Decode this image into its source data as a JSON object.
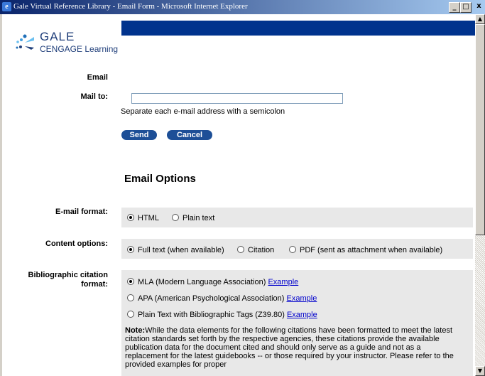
{
  "window": {
    "title": "Gale Virtual Reference Library - Email Form - Microsoft Internet Explorer",
    "min": "_",
    "max": "□",
    "close": "x"
  },
  "logo": {
    "name": "GALE",
    "subtitle": "CENGAGE Learning"
  },
  "form": {
    "email_label": "Email",
    "mail_to_label": "Mail to:",
    "mail_to_value": "",
    "hint": "Separate each e-mail address with a semicolon",
    "send": "Send",
    "cancel": "Cancel"
  },
  "options": {
    "title": "Email Options",
    "format_label": "E-mail format:",
    "format_options": [
      "HTML",
      "Plain text"
    ],
    "content_label": "Content options:",
    "content_options": [
      "Full text (when available)",
      "Citation",
      "PDF (sent as attachment when available)"
    ],
    "biblio_label_1": "Bibliographic citation",
    "biblio_label_2": "format:",
    "biblio_options": [
      {
        "label": "MLA (Modern Language Association)",
        "link": "Example"
      },
      {
        "label": "APA (American Psychological Association)",
        "link": "Example"
      },
      {
        "label": "Plain Text with Bibliographic Tags (Z39.80)",
        "link": "Example"
      }
    ],
    "note_bold": "Note:",
    "note_text": "While the data elements for the following citations have been formatted to meet the latest citation standards set forth by the respective agencies, these citations provide the available publication data for the document cited and should only serve as a guide and not as a replacement for the latest guidebooks -- or those required by your instructor. Please refer to the provided examples for proper"
  },
  "colors": {
    "accent": "#00338d",
    "button": "#1d4f97",
    "option_bg": "#e8e8e8",
    "link": "#0000cc"
  }
}
